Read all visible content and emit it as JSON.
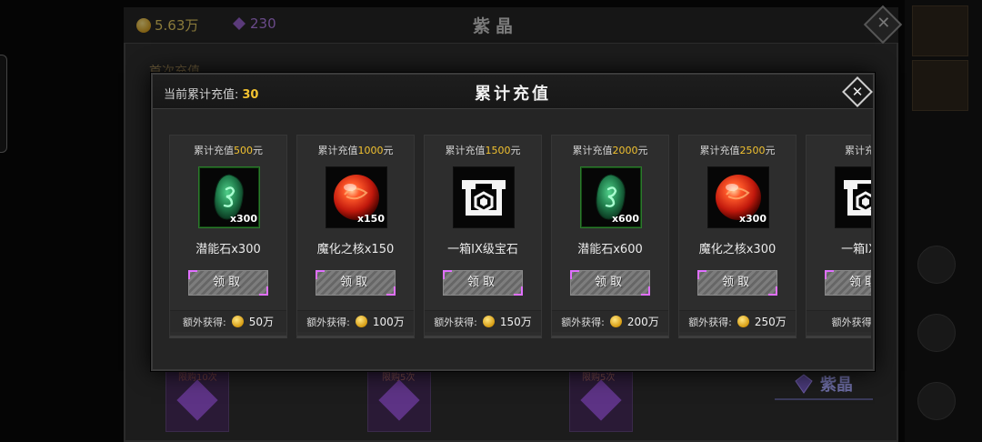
{
  "background": {
    "gold_amount": "5.63万",
    "gem_amount": "230",
    "screen_title": "紫晶",
    "first_recharge_label": "首次充值",
    "side_button_label": "紫晶",
    "limit_labels": [
      "限购10次",
      "限购5次",
      "限购5次"
    ]
  },
  "modal": {
    "title": "累计充值",
    "current_label": "当前累计充值:",
    "current_value": "30",
    "close_icon": "close-x-icon",
    "claim_label": "领取",
    "bonus_label": "额外获得:",
    "rewards": [
      {
        "goal_prefix": "累计充值",
        "goal_amount": "500",
        "goal_suffix": "元",
        "item_name": "潜能石x300",
        "qty": "x300",
        "icon": "potential-stone-icon",
        "bonus": "50万"
      },
      {
        "goal_prefix": "累计充值",
        "goal_amount": "1000",
        "goal_suffix": "元",
        "item_name": "魔化之核x150",
        "qty": "x150",
        "icon": "demon-core-orb-icon",
        "bonus": "100万"
      },
      {
        "goal_prefix": "累计充值",
        "goal_amount": "1500",
        "goal_suffix": "元",
        "item_name": "一箱IX级宝石",
        "qty": "",
        "icon": "gem-chest-icon",
        "bonus": "150万"
      },
      {
        "goal_prefix": "累计充值",
        "goal_amount": "2000",
        "goal_suffix": "元",
        "item_name": "潜能石x600",
        "qty": "x600",
        "icon": "potential-stone-icon",
        "bonus": "200万"
      },
      {
        "goal_prefix": "累计充值",
        "goal_amount": "2500",
        "goal_suffix": "元",
        "item_name": "魔化之核x300",
        "qty": "x300",
        "icon": "demon-core-orb-icon",
        "bonus": "250万"
      },
      {
        "goal_prefix": "累计充值",
        "goal_amount": "",
        "goal_suffix": "",
        "item_name": "一箱IX级",
        "qty": "",
        "icon": "gem-chest-icon",
        "bonus": ""
      }
    ]
  },
  "colors": {
    "accent_gold": "#f2c230",
    "stone_green": "#2c7a2c",
    "orb_red": "#d02010",
    "claim_corner": "#e070ff"
  }
}
